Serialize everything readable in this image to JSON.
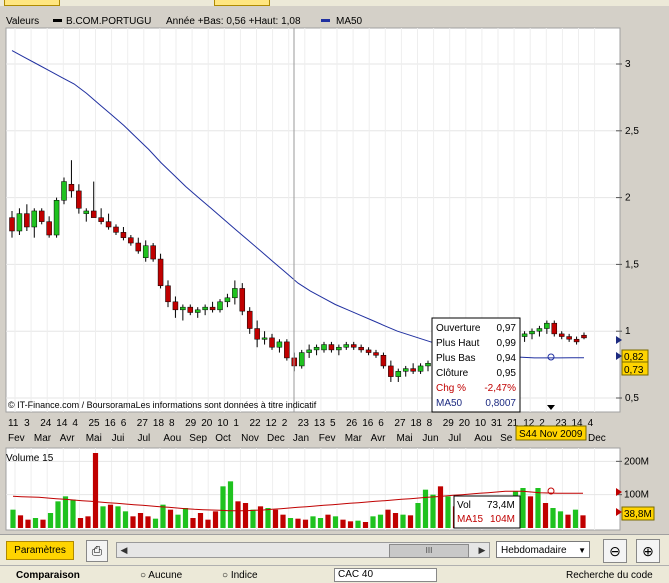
{
  "header": {
    "valeurs_label": "Valeurs",
    "symbol": "B.COM.PORTUGU",
    "range_text": "Année +Bas: 0,56 +Haut: 1,08",
    "ma_label": "MA50"
  },
  "credits": "© IT-Finance.com / BoursoramaLes informations sont données à titre indicatif",
  "tooltip": {
    "rows": [
      {
        "label": "Ouverture",
        "value": "0,97"
      },
      {
        "label": "Plus Haut",
        "value": "0,99"
      },
      {
        "label": "Plus Bas",
        "value": "0,94"
      },
      {
        "label": "Clôture",
        "value": "0,95"
      },
      {
        "label": "Chg %",
        "value": "-2,47%"
      },
      {
        "label": "MA50",
        "value": "0,8007"
      }
    ]
  },
  "price_axis": {
    "ticks": [
      "3",
      "2,5",
      "2",
      "1,5",
      "1",
      "0,5"
    ]
  },
  "price_markers": {
    "last": "0,82",
    "ma": "0,73"
  },
  "date_labels": [
    "11",
    "3",
    "24",
    "14",
    "4",
    "25",
    "16",
    "6",
    "27",
    "18",
    "8",
    "29",
    "20",
    "10",
    "1",
    "22",
    "12",
    "2",
    "23",
    "13",
    "5",
    "26",
    "16",
    "6",
    "27",
    "18",
    "8",
    "29",
    "20",
    "10",
    "31",
    "21",
    "12",
    "2",
    "23",
    "14",
    "4"
  ],
  "month_labels": [
    "Fev",
    "Mar",
    "Avr",
    "Mai",
    "Jui",
    "Jul",
    "Aou",
    "Sep",
    "Oct",
    "Nov",
    "Dec",
    "Jan",
    "Fev",
    "Mar",
    "Avr",
    "Mai",
    "Jun",
    "Jul",
    "Aou",
    "Se"
  ],
  "month_label_end": "Dec",
  "cursor_date": "S44 Nov 2009",
  "volume": {
    "title": "Volume 15",
    "axis_ticks": [
      "200M",
      "100M"
    ],
    "marker": "38,8M",
    "tooltip_rows": [
      {
        "label": "Vol",
        "value": "73,4M"
      },
      {
        "label": "MA15",
        "value": "104M"
      }
    ]
  },
  "toolbar": {
    "params_label": "Paramètres",
    "period_value": "Hebdomadaire",
    "scroll_thumb": "III"
  },
  "bottom_bar": {
    "comparaison": "Comparaison",
    "aucune": "Aucune",
    "indice": "Indice",
    "index_value": "CAC 40",
    "search": "Recherche du code"
  },
  "colors": {
    "up": "#1fc21f",
    "down": "#c00000",
    "ma": "#2030a0",
    "accent": "#ffd400"
  },
  "chart_data": {
    "type": "candlestick",
    "title": "",
    "series_name": "B.COM.PORTUGU",
    "ylim": [
      0.5,
      3.25
    ],
    "candles": [
      [
        1.85,
        1.9,
        1.7,
        1.75
      ],
      [
        1.75,
        1.92,
        1.72,
        1.88
      ],
      [
        1.88,
        1.95,
        1.75,
        1.78
      ],
      [
        1.78,
        1.92,
        1.7,
        1.9
      ],
      [
        1.9,
        1.92,
        1.8,
        1.82
      ],
      [
        1.82,
        1.86,
        1.7,
        1.72
      ],
      [
        1.72,
        2.0,
        1.7,
        1.98
      ],
      [
        1.98,
        2.15,
        1.95,
        2.12
      ],
      [
        2.1,
        2.28,
        2.0,
        2.05
      ],
      [
        2.05,
        2.1,
        1.88,
        1.92
      ],
      [
        1.88,
        1.92,
        1.82,
        1.9
      ],
      [
        1.9,
        2.12,
        1.86,
        1.85
      ],
      [
        1.85,
        1.92,
        1.8,
        1.82
      ],
      [
        1.82,
        1.88,
        1.76,
        1.78
      ],
      [
        1.78,
        1.8,
        1.72,
        1.74
      ],
      [
        1.74,
        1.78,
        1.68,
        1.7
      ],
      [
        1.7,
        1.72,
        1.64,
        1.66
      ],
      [
        1.66,
        1.7,
        1.58,
        1.6
      ],
      [
        1.55,
        1.68,
        1.52,
        1.64
      ],
      [
        1.64,
        1.66,
        1.52,
        1.54
      ],
      [
        1.54,
        1.58,
        1.32,
        1.34
      ],
      [
        1.34,
        1.38,
        1.18,
        1.22
      ],
      [
        1.22,
        1.26,
        1.1,
        1.16
      ],
      [
        1.16,
        1.2,
        1.08,
        1.18
      ],
      [
        1.18,
        1.2,
        1.12,
        1.14
      ],
      [
        1.14,
        1.18,
        1.1,
        1.16
      ],
      [
        1.16,
        1.2,
        1.12,
        1.18
      ],
      [
        1.18,
        1.22,
        1.14,
        1.16
      ],
      [
        1.16,
        1.24,
        1.14,
        1.22
      ],
      [
        1.22,
        1.28,
        1.18,
        1.25
      ],
      [
        1.25,
        1.38,
        1.2,
        1.32
      ],
      [
        1.32,
        1.36,
        1.12,
        1.15
      ],
      [
        1.15,
        1.18,
        0.98,
        1.02
      ],
      [
        1.02,
        1.08,
        0.88,
        0.94
      ],
      [
        0.94,
        1.0,
        0.9,
        0.95
      ],
      [
        0.95,
        0.98,
        0.86,
        0.88
      ],
      [
        0.88,
        0.94,
        0.84,
        0.92
      ],
      [
        0.92,
        0.94,
        0.78,
        0.8
      ],
      [
        0.8,
        0.84,
        0.7,
        0.74
      ],
      [
        0.74,
        0.86,
        0.72,
        0.84
      ],
      [
        0.84,
        0.9,
        0.8,
        0.86
      ],
      [
        0.86,
        0.9,
        0.82,
        0.88
      ],
      [
        0.86,
        0.92,
        0.84,
        0.9
      ],
      [
        0.9,
        0.92,
        0.84,
        0.86
      ],
      [
        0.86,
        0.9,
        0.82,
        0.88
      ],
      [
        0.88,
        0.92,
        0.86,
        0.9
      ],
      [
        0.9,
        0.92,
        0.86,
        0.88
      ],
      [
        0.88,
        0.9,
        0.84,
        0.86
      ],
      [
        0.86,
        0.88,
        0.82,
        0.84
      ],
      [
        0.84,
        0.86,
        0.8,
        0.82
      ],
      [
        0.82,
        0.84,
        0.72,
        0.74
      ],
      [
        0.74,
        0.78,
        0.62,
        0.66
      ],
      [
        0.66,
        0.72,
        0.62,
        0.7
      ],
      [
        0.7,
        0.74,
        0.66,
        0.72
      ],
      [
        0.72,
        0.76,
        0.68,
        0.7
      ],
      [
        0.7,
        0.76,
        0.68,
        0.74
      ],
      [
        0.74,
        0.78,
        0.7,
        0.76
      ],
      [
        0.76,
        0.82,
        0.72,
        0.8
      ],
      [
        0.8,
        0.84,
        0.74,
        0.78
      ],
      [
        0.78,
        0.9,
        0.76,
        0.88
      ],
      [
        0.88,
        0.92,
        0.8,
        0.82
      ],
      [
        0.82,
        0.88,
        0.8,
        0.86
      ],
      [
        0.86,
        0.9,
        0.82,
        0.84
      ],
      [
        0.84,
        0.88,
        0.8,
        0.86
      ],
      [
        0.86,
        0.92,
        0.84,
        0.9
      ],
      [
        0.9,
        0.94,
        0.86,
        0.88
      ],
      [
        0.88,
        0.94,
        0.86,
        0.92
      ],
      [
        0.92,
        0.96,
        0.88,
        0.94
      ],
      [
        0.94,
        0.98,
        0.9,
        0.96
      ],
      [
        0.96,
        1.0,
        0.92,
        0.98
      ],
      [
        0.98,
        1.02,
        0.94,
        1.0
      ],
      [
        1.0,
        1.04,
        0.96,
        1.02
      ],
      [
        1.02,
        1.08,
        0.98,
        1.06
      ],
      [
        1.06,
        1.08,
        0.96,
        0.98
      ],
      [
        0.98,
        1.0,
        0.94,
        0.96
      ],
      [
        0.96,
        0.98,
        0.92,
        0.94
      ],
      [
        0.94,
        0.96,
        0.9,
        0.92
      ],
      [
        0.97,
        0.99,
        0.94,
        0.95
      ]
    ],
    "ma50": [
      3.1,
      3.05,
      3.0,
      2.95,
      2.9,
      2.85,
      2.78,
      2.7,
      2.62,
      2.54,
      2.45,
      2.36,
      2.26,
      2.17,
      2.08,
      2.0,
      1.92,
      1.84,
      1.76,
      1.68,
      1.6,
      1.52,
      1.44,
      1.36,
      1.3,
      1.25,
      1.2,
      1.16,
      1.12,
      1.08,
      1.04,
      1.0,
      0.97,
      0.94,
      0.91,
      0.88,
      0.86,
      0.84,
      0.83,
      0.82,
      0.81,
      0.805,
      0.8,
      0.8,
      0.8,
      0.801,
      0.8007
    ],
    "volume": {
      "ylim": [
        0,
        240
      ],
      "values": [
        55,
        38,
        25,
        30,
        25,
        45,
        80,
        95,
        85,
        30,
        35,
        225,
        65,
        70,
        65,
        50,
        35,
        45,
        35,
        28,
        70,
        55,
        40,
        60,
        30,
        45,
        25,
        50,
        125,
        140,
        80,
        75,
        55,
        65,
        60,
        55,
        40,
        30,
        28,
        25,
        35,
        30,
        40,
        35,
        25,
        20,
        22,
        18,
        35,
        40,
        55,
        45,
        40,
        38,
        75,
        115,
        100,
        125,
        95,
        65,
        55,
        45,
        70,
        60,
        80,
        90,
        60,
        110,
        120,
        95,
        120,
        75,
        60,
        50,
        40,
        55,
        38
      ],
      "up": [
        1,
        0,
        0,
        1,
        0,
        1,
        1,
        1,
        1,
        0,
        0,
        0,
        1,
        0,
        1,
        1,
        0,
        0,
        0,
        1,
        1,
        0,
        1,
        1,
        0,
        0,
        0,
        0,
        1,
        1,
        0,
        0,
        1,
        0,
        1,
        0,
        0,
        1,
        0,
        0,
        1,
        1,
        0,
        1,
        0,
        0,
        1,
        0,
        1,
        1,
        0,
        0,
        1,
        0,
        1,
        1,
        1,
        0,
        1,
        0,
        1,
        0,
        1,
        1,
        0,
        1,
        0,
        1,
        1,
        0,
        1,
        0,
        1,
        1,
        0,
        1,
        0
      ],
      "ma15": [
        95,
        94,
        93,
        92,
        90,
        88,
        86,
        84,
        82,
        80,
        78,
        76,
        74,
        72,
        70,
        68,
        66,
        64,
        62,
        60,
        58,
        56,
        55,
        54,
        53,
        52,
        52,
        52,
        53,
        54,
        56,
        58,
        60,
        62,
        64,
        66,
        68,
        70,
        72,
        74,
        76,
        78,
        80,
        82,
        84,
        86,
        88,
        90,
        92,
        94,
        96,
        98,
        100,
        102,
        104,
        106,
        108,
        110,
        110,
        110,
        108,
        106,
        105,
        104,
        104,
        104,
        104
      ]
    }
  }
}
